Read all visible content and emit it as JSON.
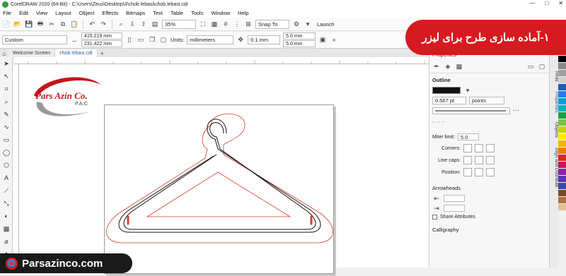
{
  "window": {
    "title": "CorelDRAW 2020 (64-Bit) - C:\\Users\\Zeus\\Desktop\\3\\chob lebasi\\chob lebasi.cdr",
    "controls": [
      "—",
      "□",
      "✕"
    ]
  },
  "menu": [
    "File",
    "Edit",
    "View",
    "Layout",
    "Object",
    "Effects",
    "Bitmaps",
    "Text",
    "Table",
    "Tools",
    "Window",
    "Help"
  ],
  "toolbar": {
    "zoom": "35%",
    "snap_to": "Snap To",
    "launch": "Launch"
  },
  "property_bar": {
    "preset": "Custom",
    "width": "415.219 mm",
    "height": "231.422 mm",
    "units_label": "Units:",
    "units": "millimeters",
    "nudge": "0.1 mm",
    "dup_x": "5.0 mm",
    "dup_y": "5.0 mm"
  },
  "tabs": [
    "Welcome Screen",
    "chob lebasi.cdr"
  ],
  "logo": {
    "name": "Pars Azin Co.",
    "sub": "P.A.C"
  },
  "banner": {
    "text": "۱-آماده سازی طرح برای لیزر"
  },
  "badge": {
    "text": "Parsazinco.com"
  },
  "panel": {
    "title": "Properties",
    "outline_label": "Outline",
    "outline_width": "0.567 pt",
    "outline_units": "points",
    "miter_label": "Miter limit:",
    "miter_value": "5.0",
    "corners_label": "Corners:",
    "line_caps_label": "Line caps:",
    "position_label": "Position:",
    "arrowheads_label": "Arrowheads",
    "share_attributes": "Share Attributes",
    "calligraphy_label": "Calligraphy"
  },
  "side_tabs": [
    "Hints",
    "Properties",
    "Objects",
    "Align and Distribute"
  ],
  "colors": {
    "accent": "#d71920",
    "palette": [
      "#ffffff",
      "#000000",
      "#888888",
      "#a0a0a0",
      "#d0d0d0",
      "#1e5bbf",
      "#2f7fd8",
      "#00a0e0",
      "#00b4b4",
      "#1aa04a",
      "#7bc043",
      "#c8d400",
      "#ffeb00",
      "#f7b500",
      "#f07d00",
      "#e2231a",
      "#c2185b",
      "#8e24aa",
      "#5e35b1",
      "#3949ab",
      "#7a4a2a",
      "#b07040",
      "#e0c090"
    ]
  }
}
